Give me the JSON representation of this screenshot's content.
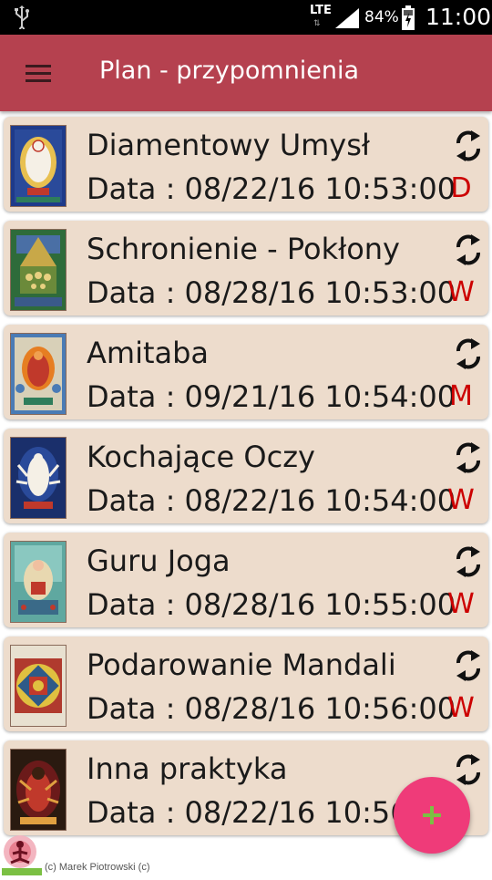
{
  "status_bar": {
    "network": "LTE",
    "battery": "84%",
    "time": "11:00",
    "icons": [
      "usb-icon",
      "signal-icon",
      "battery-icon"
    ]
  },
  "app_bar": {
    "title": "Plan - przypomnienia",
    "menu_icon": "hamburger-menu-icon",
    "color": "#b5414f"
  },
  "reminders": [
    {
      "name": "Diamentowy Umysł",
      "date": "Data : 08/22/16 10:53:00",
      "frequency": "D",
      "thumb_colors": [
        "#1e3a8a",
        "#c0392b",
        "#f5f0e6"
      ]
    },
    {
      "name": "Schronienie - Pokłony",
      "date": "Data : 08/28/16 10:53:00",
      "frequency": "W",
      "thumb_colors": [
        "#2e6b3a",
        "#c8a848",
        "#4a6fa5"
      ]
    },
    {
      "name": "Amitaba",
      "date": "Data : 09/21/16 10:54:00",
      "frequency": "M",
      "thumb_colors": [
        "#c0392b",
        "#e67e22",
        "#4a7bb5"
      ]
    },
    {
      "name": "Kochające Oczy",
      "date": "Data : 08/22/16 10:54:00",
      "frequency": "W",
      "thumb_colors": [
        "#1a2f6b",
        "#f5f0e6",
        "#c0392b"
      ]
    },
    {
      "name": "Guru Joga",
      "date": "Data : 08/28/16 10:55:00",
      "frequency": "W",
      "thumb_colors": [
        "#5fa8a0",
        "#e8d8b0",
        "#c0392b"
      ]
    },
    {
      "name": "Podarowanie Mandali",
      "date": "Data : 08/28/16 10:56:00",
      "frequency": "W",
      "thumb_colors": [
        "#b03a2e",
        "#e0c040",
        "#2e5a88"
      ]
    },
    {
      "name": "Inna praktyka",
      "date": "Data : 08/22/16 10:56:00",
      "frequency": "",
      "thumb_colors": [
        "#6b1a1a",
        "#c0392b",
        "#2a1a10"
      ]
    }
  ],
  "fab": {
    "icon": "plus-icon",
    "color": "#ef3b79"
  },
  "footer": {
    "copyright": "(c) Marek Piotrowski (c)"
  },
  "colors": {
    "card_bg": "#eddccc",
    "frequency_text": "#cc0000"
  }
}
